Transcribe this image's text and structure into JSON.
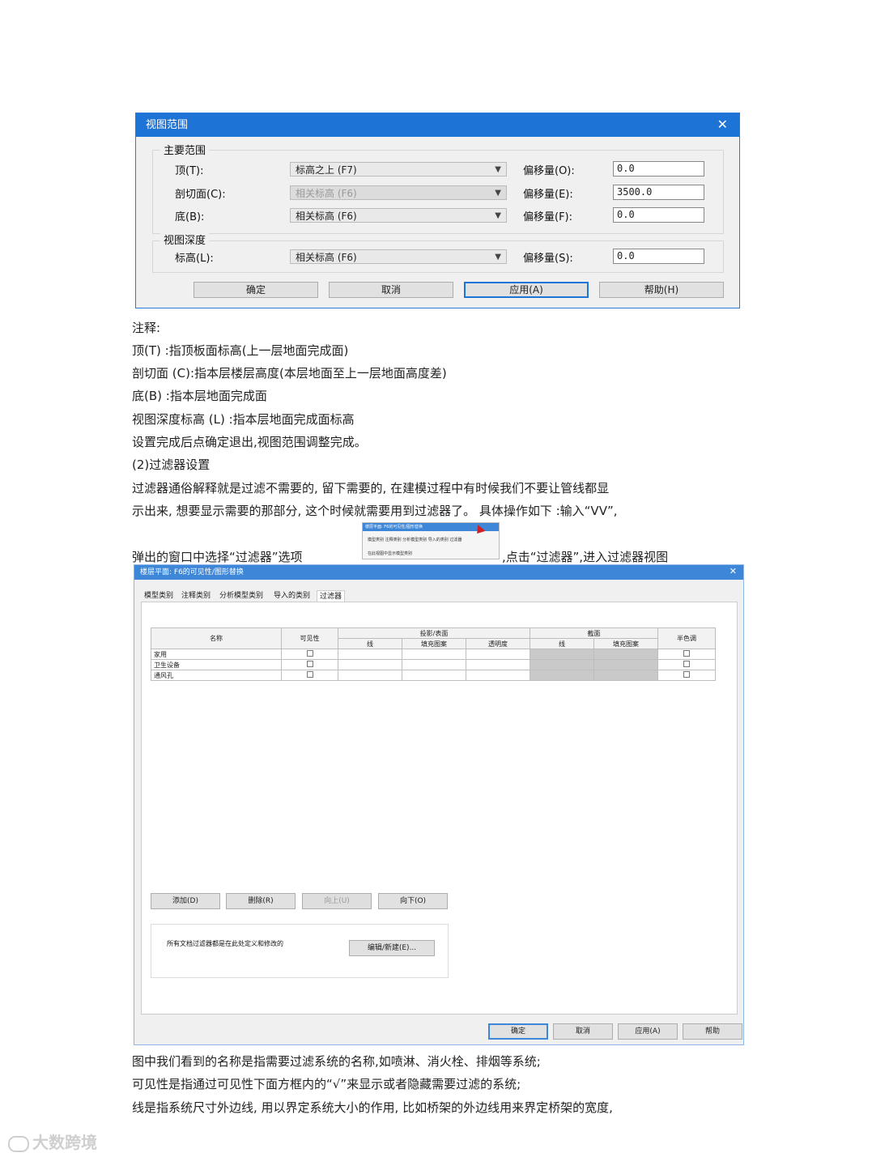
{
  "view_range": {
    "title": "视图范围",
    "close": "✕",
    "primary_group": "主要范围",
    "top_label": "顶(T):",
    "top_value": "标高之上 (F7)",
    "top_offset_label": "偏移量(O):",
    "top_offset": "0.0",
    "cut_label": "剖切面(C):",
    "cut_value": "相关标高 (F6)",
    "cut_offset_label": "偏移量(E):",
    "cut_offset": "3500.0",
    "bottom_label": "底(B):",
    "bottom_value": "相关标高 (F6)",
    "bottom_offset_label": "偏移量(F):",
    "bottom_offset": "0.0",
    "depth_group": "视图深度",
    "level_label": "标高(L):",
    "level_value": "相关标高 (F6)",
    "level_offset_label": "偏移量(S):",
    "level_offset": "0.0",
    "buttons": [
      "确定",
      "取消",
      "应用(A)",
      "帮助(H)"
    ]
  },
  "text": {
    "note": "注释:",
    "l1": "顶(T) :指顶板面标高(上一层地面完成面)",
    "l2": "剖切面 (C):指本层楼层高度(本层地面至上一层地面高度差)",
    "l3": "底(B) :指本层地面完成面",
    "l4": "视图深度标高 (L) :指本层地面完成面标高",
    "l5": "设置完成后点确定退出,视图范围调整完成。",
    "l6": "(2)过滤器设置",
    "l7": "过滤器通俗解释就是过滤不需要的,     留下需要的,  在建模过程中有时候我们不要让管线都显",
    "l8": "示出来,  想要显示需要的那部分,     这个时候就需要用到过滤器了。     具体操作如下 :输入“VV”,",
    "l9a": "弹出的窗口中选择“过滤器”选项",
    "l9b": ",点击“过滤器”,进入过滤器视图",
    "b1": "图中我们看到的名称是指需要过滤系统的名称,如喷淋、消火栓、排烟等系统;",
    "b2": "可见性是指通过可见性下面方框内的“√”来显示或者隐藏需要过滤的系统;",
    "b3": "线是指系统尺寸外边线,  用以界定系统大小的作用,    比如桥架的外边线用来界定桥架的宽度,"
  },
  "thumb": {
    "title": "楼层平面: F6的可见性/图形替换",
    "tabs": "模型类别  注释类别  分析模型类别  导入的类别  过滤器",
    "check": "在此视图中显示模型类别"
  },
  "vg": {
    "title": "楼层平面: F6的可见性/图形替换",
    "close": "✕",
    "tabs": [
      "模型类别",
      "注释类别",
      "分析模型类别",
      "导入的类别",
      "过滤器"
    ],
    "headers": {
      "name": "名称",
      "visibility": "可见性",
      "projection": "投影/表面",
      "line": "线",
      "fill": "填充图案",
      "transparency": "透明度",
      "cut": "截面",
      "cut_line": "线",
      "cut_fill": "填充图案",
      "halftone": "半色调"
    },
    "rows": [
      "家用",
      "卫生设备",
      "通风孔"
    ],
    "buttons": [
      "添加(D)",
      "删除(R)",
      "向上(U)",
      "向下(O)"
    ],
    "info": "所有文档过滤器都是在此处定义和修改的",
    "edit_button": "编辑/新建(E)...",
    "footer_buttons": [
      "确定",
      "取消",
      "应用(A)",
      "帮助"
    ]
  },
  "watermark": "大数跨境"
}
